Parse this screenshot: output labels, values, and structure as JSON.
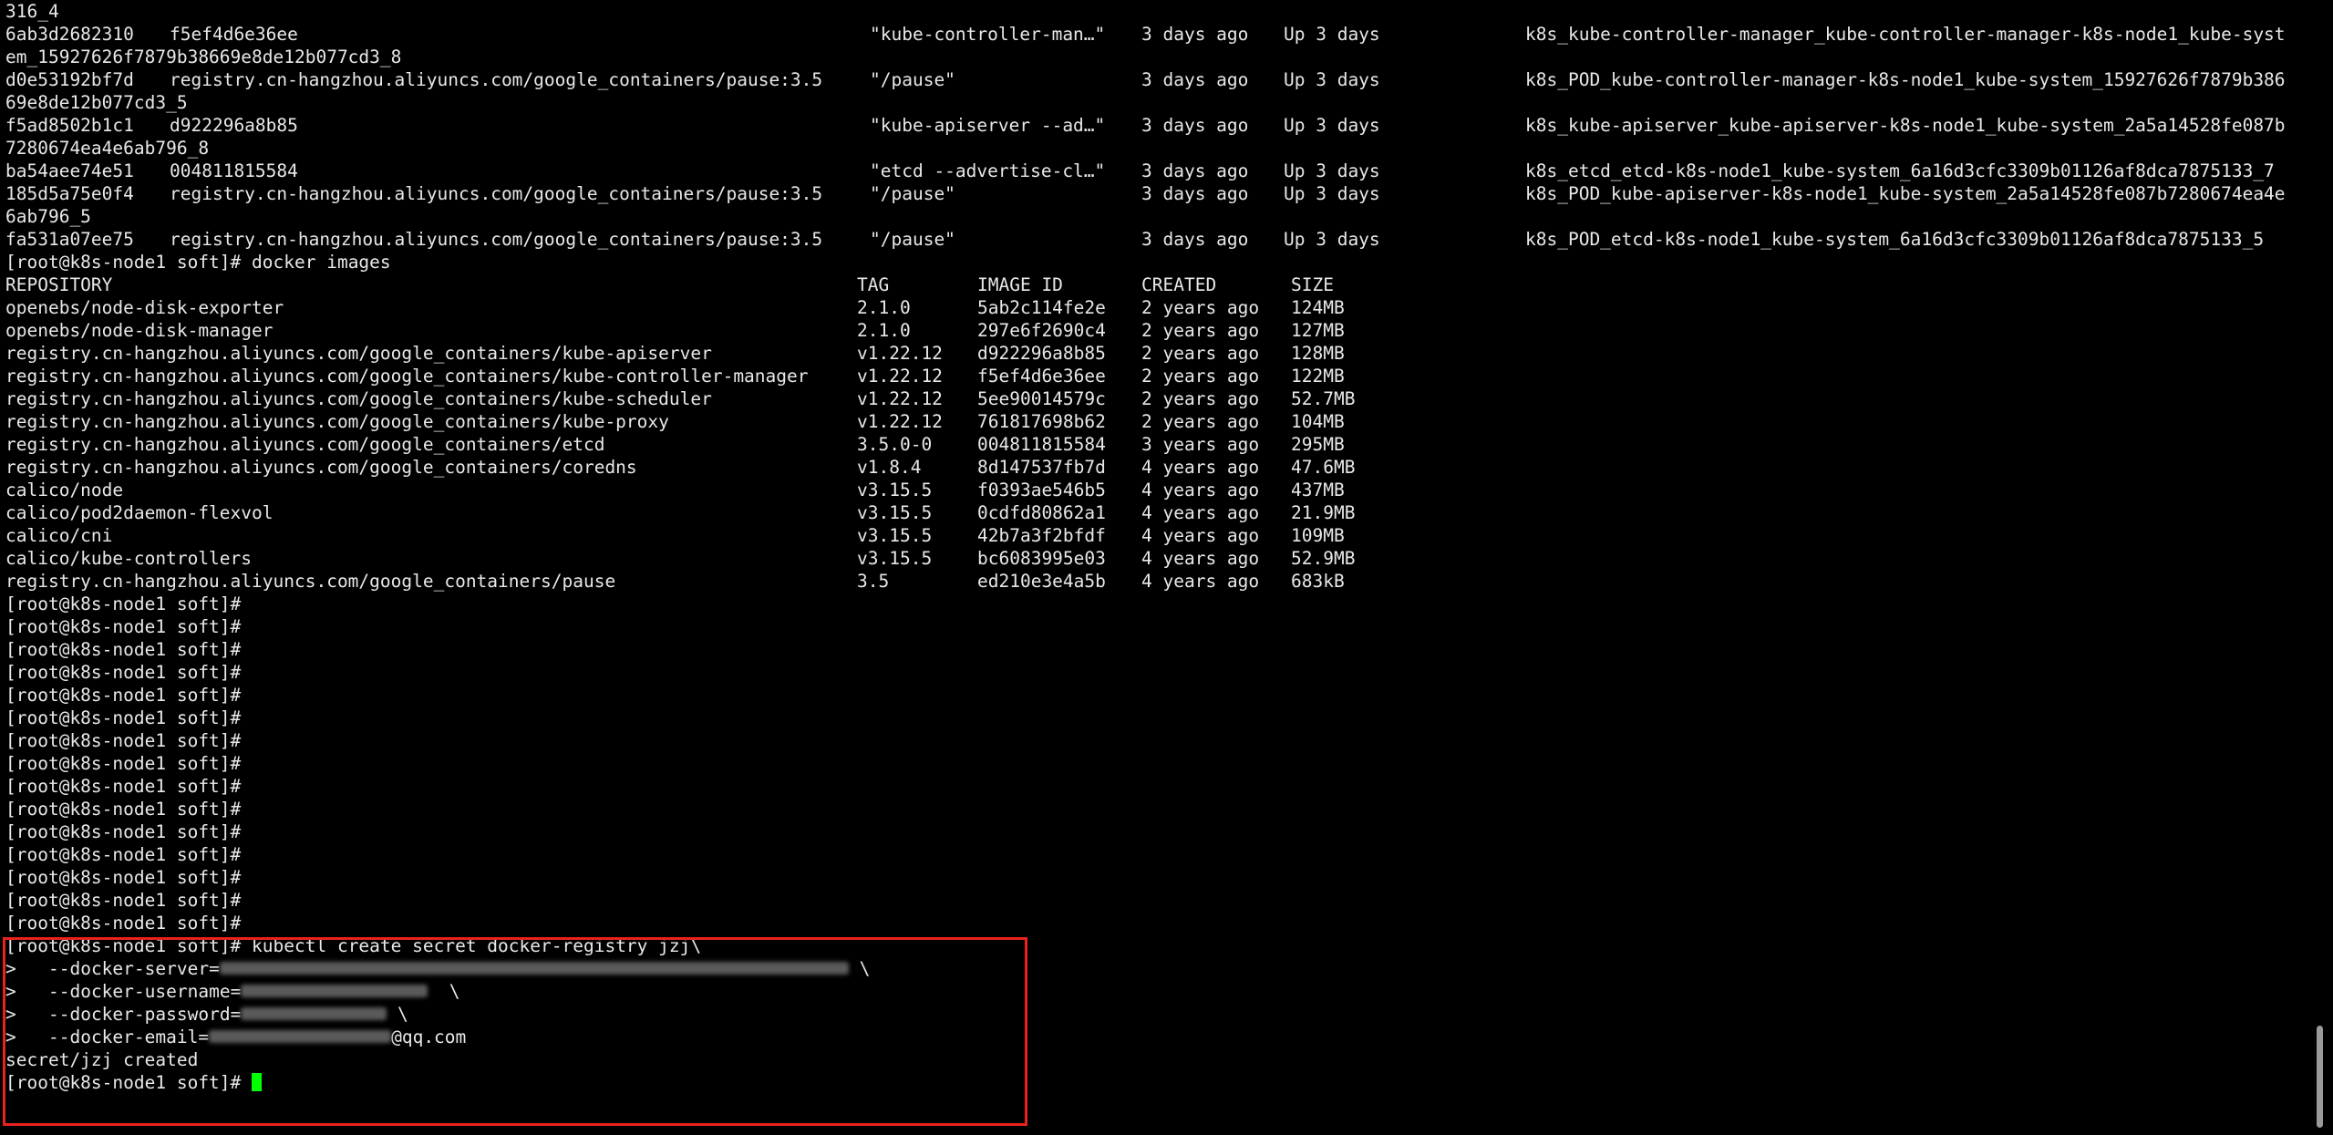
{
  "terminal": {
    "prompt": "[root@k8s-node1 soft]#",
    "ps_header_tail": "316_4",
    "ps_rows": [
      {
        "id": "6ab3d2682310",
        "image": "f5ef4d6e36ee",
        "command": "\"kube-controller-man…\"",
        "created": "3 days ago",
        "status": "Up 3 days",
        "name": "k8s_kube-controller-manager_kube-controller-manager-k8s-node1_kube-syst",
        "name_wrap": "em_15927626f7879b38669e8de12b077cd3_8"
      },
      {
        "id": "d0e53192bf7d",
        "image": "registry.cn-hangzhou.aliyuncs.com/google_containers/pause:3.5",
        "command": "\"/pause\"",
        "created": "3 days ago",
        "status": "Up 3 days",
        "name": "k8s_POD_kube-controller-manager-k8s-node1_kube-system_15927626f7879b386",
        "name_wrap": "69e8de12b077cd3_5"
      },
      {
        "id": "f5ad8502b1c1",
        "image": "d922296a8b85",
        "command": "\"kube-apiserver --ad…\"",
        "created": "3 days ago",
        "status": "Up 3 days",
        "name": "k8s_kube-apiserver_kube-apiserver-k8s-node1_kube-system_2a5a14528fe087b",
        "name_wrap": "7280674ea4e6ab796_8"
      },
      {
        "id": "ba54aee74e51",
        "image": "004811815584",
        "command": "\"etcd --advertise-cl…\"",
        "created": "3 days ago",
        "status": "Up 3 days",
        "name": "k8s_etcd_etcd-k8s-node1_kube-system_6a16d3cfc3309b01126af8dca7875133_7",
        "name_wrap": ""
      },
      {
        "id": "185d5a75e0f4",
        "image": "registry.cn-hangzhou.aliyuncs.com/google_containers/pause:3.5",
        "command": "\"/pause\"",
        "created": "3 days ago",
        "status": "Up 3 days",
        "name": "k8s_POD_kube-apiserver-k8s-node1_kube-system_2a5a14528fe087b7280674ea4e",
        "name_wrap": "6ab796_5"
      },
      {
        "id": "fa531a07ee75",
        "image": "registry.cn-hangzhou.aliyuncs.com/google_containers/pause:3.5",
        "command": "\"/pause\"",
        "created": "3 days ago",
        "status": "Up 3 days",
        "name": "k8s_POD_etcd-k8s-node1_kube-system_6a16d3cfc3309b01126af8dca7875133_5",
        "name_wrap": ""
      }
    ],
    "images_command": "docker images",
    "images_header": {
      "repository": "REPOSITORY",
      "tag": "TAG",
      "image_id": "IMAGE ID",
      "created": "CREATED",
      "size": "SIZE"
    },
    "images_rows": [
      {
        "repository": "openebs/node-disk-exporter",
        "tag": "2.1.0",
        "image_id": "5ab2c114fe2e",
        "created": "2 years ago",
        "size": "124MB"
      },
      {
        "repository": "openebs/node-disk-manager",
        "tag": "2.1.0",
        "image_id": "297e6f2690c4",
        "created": "2 years ago",
        "size": "127MB"
      },
      {
        "repository": "registry.cn-hangzhou.aliyuncs.com/google_containers/kube-apiserver",
        "tag": "v1.22.12",
        "image_id": "d922296a8b85",
        "created": "2 years ago",
        "size": "128MB"
      },
      {
        "repository": "registry.cn-hangzhou.aliyuncs.com/google_containers/kube-controller-manager",
        "tag": "v1.22.12",
        "image_id": "f5ef4d6e36ee",
        "created": "2 years ago",
        "size": "122MB"
      },
      {
        "repository": "registry.cn-hangzhou.aliyuncs.com/google_containers/kube-scheduler",
        "tag": "v1.22.12",
        "image_id": "5ee90014579c",
        "created": "2 years ago",
        "size": "52.7MB"
      },
      {
        "repository": "registry.cn-hangzhou.aliyuncs.com/google_containers/kube-proxy",
        "tag": "v1.22.12",
        "image_id": "761817698b62",
        "created": "2 years ago",
        "size": "104MB"
      },
      {
        "repository": "registry.cn-hangzhou.aliyuncs.com/google_containers/etcd",
        "tag": "3.5.0-0",
        "image_id": "004811815584",
        "created": "3 years ago",
        "size": "295MB"
      },
      {
        "repository": "registry.cn-hangzhou.aliyuncs.com/google_containers/coredns",
        "tag": "v1.8.4",
        "image_id": "8d147537fb7d",
        "created": "4 years ago",
        "size": "47.6MB"
      },
      {
        "repository": "calico/node",
        "tag": "v3.15.5",
        "image_id": "f0393ae546b5",
        "created": "4 years ago",
        "size": "437MB"
      },
      {
        "repository": "calico/pod2daemon-flexvol",
        "tag": "v3.15.5",
        "image_id": "0cdfd80862a1",
        "created": "4 years ago",
        "size": "21.9MB"
      },
      {
        "repository": "calico/cni",
        "tag": "v3.15.5",
        "image_id": "42b7a3f2bfdf",
        "created": "4 years ago",
        "size": "109MB"
      },
      {
        "repository": "calico/kube-controllers",
        "tag": "v3.15.5",
        "image_id": "bc6083995e03",
        "created": "4 years ago",
        "size": "52.9MB"
      },
      {
        "repository": "registry.cn-hangzhou.aliyuncs.com/google_containers/pause",
        "tag": "3.5",
        "image_id": "ed210e3e4a5b",
        "created": "4 years ago",
        "size": "683kB"
      }
    ],
    "kubectl": {
      "command": "kubectl create secret docker-registry jzj\\",
      "continuation": ">",
      "server_flag": "--docker-server=",
      "server_tail": " \\",
      "username_flag": "--docker-username=",
      "username_tail": "  \\",
      "password_flag": "--docker-password=",
      "password_tail": " \\",
      "email_flag": "--docker-email=",
      "email_tail": "@qq.com",
      "result": "secret/jzj created"
    }
  }
}
